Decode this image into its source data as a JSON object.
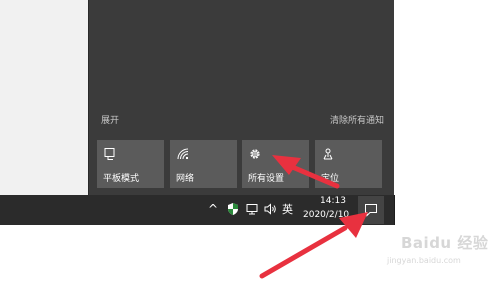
{
  "action_center": {
    "expand_label": "展开",
    "clear_all_label": "清除所有通知",
    "tiles": [
      {
        "label": "平板模式",
        "icon": "tablet-mode-icon"
      },
      {
        "label": "网络",
        "icon": "network-icon"
      },
      {
        "label": "所有设置",
        "icon": "gear-icon"
      },
      {
        "label": "定位",
        "icon": "location-icon"
      }
    ]
  },
  "taskbar": {
    "ime_label": "英",
    "time": "14:13",
    "date": "2020/2/10"
  },
  "watermark": {
    "brand": "Baidu 经验",
    "url": "jingyan.baidu.com"
  },
  "colors": {
    "panel_bg": "#3b3b3b",
    "tile_bg": "#5b5b5b",
    "taskbar_bg": "#2b2b2b",
    "arrow_red": "#e8313f"
  }
}
